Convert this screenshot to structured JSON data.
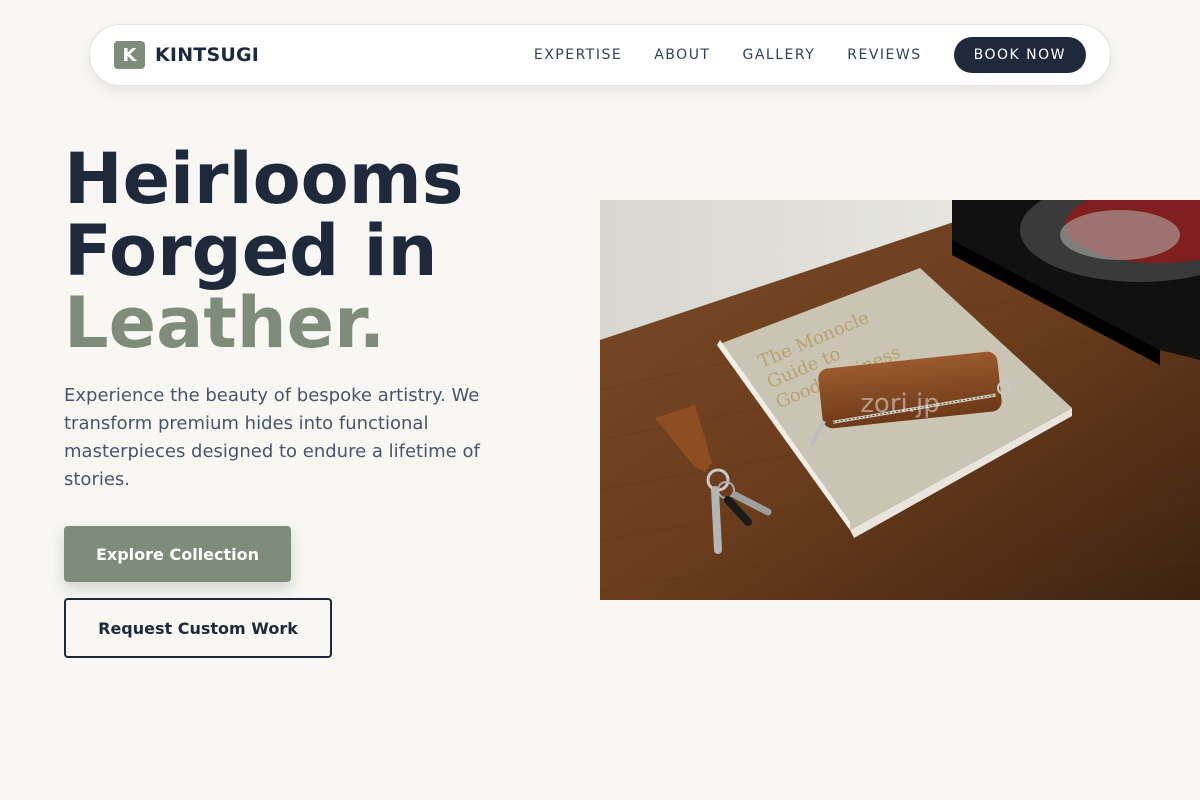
{
  "brand": {
    "mark": "K",
    "name": "KINTSUGI"
  },
  "nav": {
    "links": [
      "EXPERTISE",
      "ABOUT",
      "GALLERY",
      "REVIEWS"
    ],
    "cta": "BOOK NOW"
  },
  "hero": {
    "title_line1": "Heirlooms",
    "title_line2": "Forged in",
    "title_line3": "Leather.",
    "description": "Experience the beauty of bespoke artistry. We transform premium hides into functional masterpieces designed to endure a lifetime of stories.",
    "primary_button": "Explore Collection",
    "secondary_button": "Request Custom Work",
    "image_watermark": "zori.jp"
  },
  "colors": {
    "background": "#f8f7f4",
    "navy": "#1e293b",
    "sage": "#7e8c79"
  }
}
